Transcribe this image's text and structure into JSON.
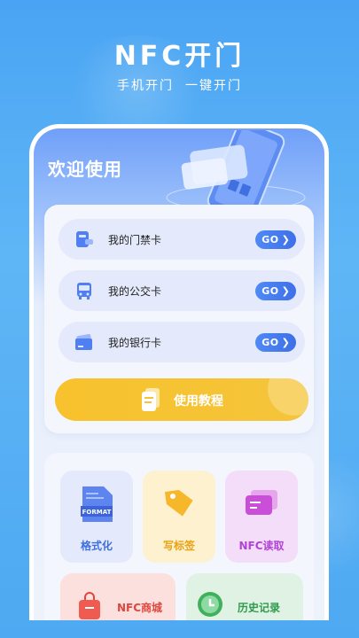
{
  "header": {
    "title": "NFC开门",
    "subtitle": "手机开门  一键开门"
  },
  "phone": {
    "welcome": "欢迎使用"
  },
  "cards": [
    {
      "label": "我的门禁卡",
      "icon": "access-card-icon",
      "go": "GO"
    },
    {
      "label": "我的公交卡",
      "icon": "bus-icon",
      "go": "GO"
    },
    {
      "label": "我的银行卡",
      "icon": "bank-card-icon",
      "go": "GO"
    }
  ],
  "tutorial": {
    "label": "使用教程",
    "icon": "document-icon"
  },
  "tools": [
    {
      "label": "格式化",
      "icon": "format-icon",
      "badge": "FORMAT",
      "color": "#3d6fe0"
    },
    {
      "label": "写标签",
      "icon": "tag-icon",
      "color": "#e8a214"
    },
    {
      "label": "NFC读取",
      "icon": "nfc-card-icon",
      "color": "#b243d6"
    },
    {
      "label": "NFC商城",
      "icon": "shopping-bag-icon",
      "color": "#e0463e"
    },
    {
      "label": "历史记录",
      "icon": "clock-icon",
      "color": "#2e9b4c"
    }
  ],
  "colors": {
    "accent": "#4f8af3",
    "tutorial": "#f7c22d"
  }
}
